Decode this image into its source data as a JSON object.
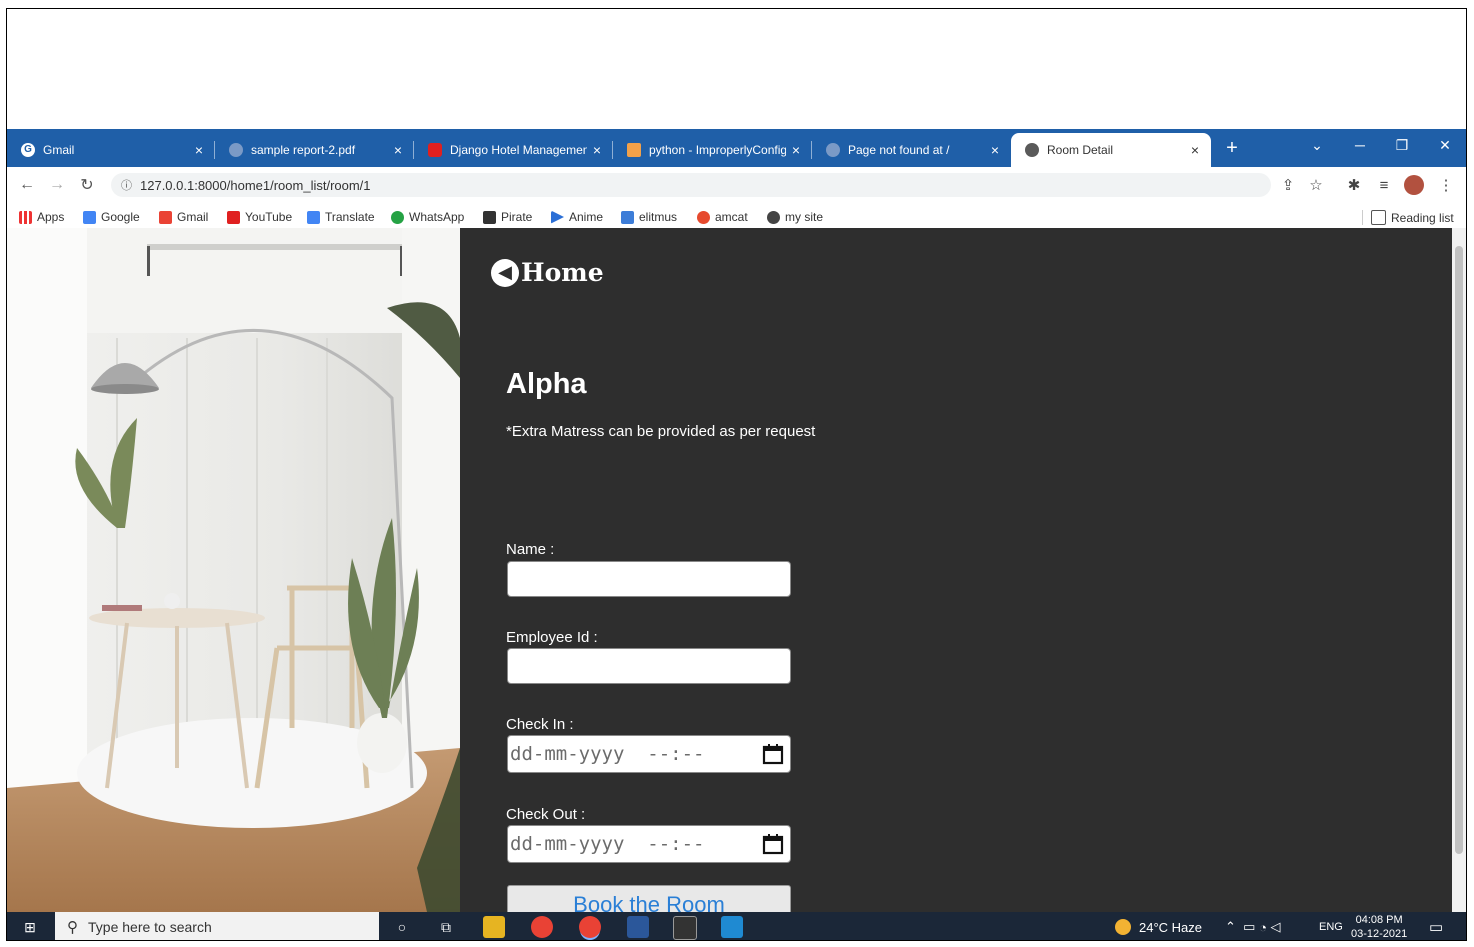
{
  "browser": {
    "tabs": [
      {
        "title": "Gmail",
        "active": false
      },
      {
        "title": "sample report-2.pdf",
        "active": false
      },
      {
        "title": "Django Hotel Management",
        "active": false
      },
      {
        "title": "python - ImproperlyConfig",
        "active": false
      },
      {
        "title": "Page not found at /",
        "active": false
      },
      {
        "title": "Room Detail",
        "active": true
      }
    ],
    "tab_close_glyph": "×",
    "new_tab_glyph": "+",
    "url": "127.0.0.1:8000/home1/room_list/room/1",
    "bookmarks": [
      "Apps",
      "Google",
      "Gmail",
      "YouTube",
      "Translate",
      "WhatsApp",
      "Pirate",
      "Anime",
      "elitmus",
      "amcat",
      "my site"
    ],
    "reading_list": "Reading list"
  },
  "page": {
    "home_link": "Home",
    "room_name": "Alpha",
    "note": "*Extra Matress can be provided as per request",
    "form": {
      "name_label": "Name :",
      "employee_label": "Employee Id :",
      "checkin_label": "Check In :",
      "checkout_label": "Check Out :",
      "datetime_placeholder": "dd-mm-yyyy  --:--",
      "submit_label": "Book the Room"
    }
  },
  "taskbar": {
    "search_placeholder": "Type here to search",
    "weather": "24°C  Haze",
    "language": "ENG",
    "time": "04:08 PM",
    "date": "03-12-2021"
  },
  "colors": {
    "tab_bar": "#1f5fa8",
    "page_bg": "#2e2e2e",
    "button_text": "#2a7fd6"
  }
}
